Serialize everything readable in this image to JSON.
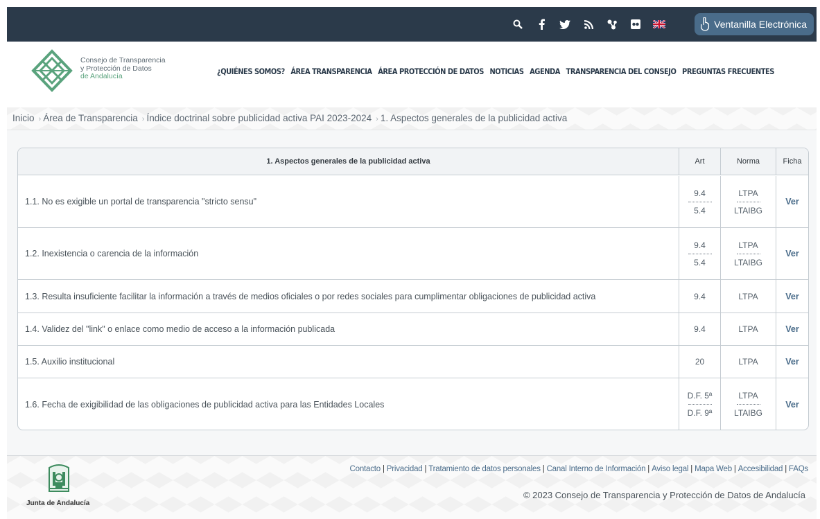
{
  "topbar": {
    "icons": [
      "search-icon",
      "facebook-icon",
      "twitter-icon",
      "rss-icon",
      "network-icon",
      "flickr-icon",
      "uk-flag-icon"
    ],
    "ventanilla_label": "Ventanilla Electrónica"
  },
  "header": {
    "logo_lines": [
      "Consejo de Transparencia",
      "y Protección de Datos",
      "de Andalucía"
    ],
    "nav": [
      "¿QUIÉNES SOMOS?",
      "ÁREA TRANSPARENCIA",
      "ÁREA PROTECCIÓN DE DATOS",
      "NOTICIAS",
      "AGENDA",
      "TRANSPARENCIA DEL CONSEJO",
      "PREGUNTAS FRECUENTES"
    ]
  },
  "breadcrumb": [
    "Inicio",
    "Área de Transparencia",
    "Índice doctrinal sobre publicidad activa PAI 2023-2024",
    "1. Aspectos generales de la publicidad activa"
  ],
  "table": {
    "headers": {
      "title": "1. Aspectos generales de la publicidad activa",
      "art": "Art",
      "norma": "Norma",
      "ficha": "Ficha"
    },
    "rows": [
      {
        "title": "1.1. No es exigible un portal de transparencia \"stricto sensu\"",
        "art": [
          "9.4",
          "5.4"
        ],
        "norma": [
          "LTPA",
          "LTAIBG"
        ],
        "ficha": "Ver"
      },
      {
        "title": "1.2. Inexistencia o carencia de la información",
        "art": [
          "9.4",
          "5.4"
        ],
        "norma": [
          "LTPA",
          "LTAIBG"
        ],
        "ficha": "Ver"
      },
      {
        "title": "1.3. Resulta insuficiente facilitar la información a través de medios oficiales o por redes sociales para cumplimentar obligaciones de publicidad activa",
        "art": [
          "9.4"
        ],
        "norma": [
          "LTPA"
        ],
        "ficha": "Ver"
      },
      {
        "title": "1.4. Validez del \"link\" o enlace como medio de acceso a la información publicada",
        "art": [
          "9.4"
        ],
        "norma": [
          "LTPA"
        ],
        "ficha": "Ver"
      },
      {
        "title": "1.5. Auxilio institucional",
        "art": [
          "20"
        ],
        "norma": [
          "LTPA"
        ],
        "ficha": "Ver"
      },
      {
        "title": "1.6. Fecha de exigibilidad de las obligaciones de publicidad activa para las Entidades Locales",
        "art": [
          "D.F. 5ª",
          "D.F. 9ª"
        ],
        "norma": [
          "LTPA",
          "LTAIBG"
        ],
        "ficha": "Ver"
      }
    ]
  },
  "footer": {
    "junta_label": "Junta de Andalucía",
    "links": [
      "Contacto",
      "Privacidad",
      "Tratamiento de datos personales",
      "Canal Interno de Información",
      "Aviso legal",
      "Mapa Web",
      "Accesibilidad",
      "FAQs"
    ],
    "copyright": "© 2023 Consejo de Transparencia y Protección de Datos de Andalucía"
  },
  "colors": {
    "topbar": "#2b3a4a",
    "accent": "#4a6c8a",
    "logo_green": "#5aa37d"
  }
}
